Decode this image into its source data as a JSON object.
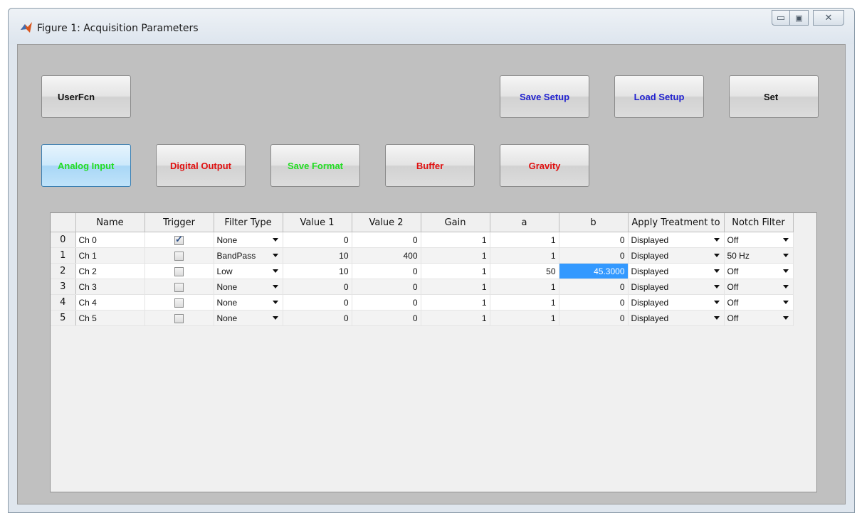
{
  "window": {
    "title": "Figure 1: Acquisition Parameters"
  },
  "buttons": {
    "userfcn": "UserFcn",
    "save_setup": "Save Setup",
    "load_setup": "Load Setup",
    "set": "Set",
    "analog_input": "Analog Input",
    "digital_output": "Digital Output",
    "save_format": "Save Format",
    "buffer": "Buffer",
    "gravity": "Gravity"
  },
  "colors": {
    "blue_label": "#1f1fd0",
    "green_label": "#22dd22",
    "red_label": "#e01010",
    "selection": "#3399ff"
  },
  "table": {
    "headers": {
      "name": "Name",
      "trigger": "Trigger",
      "filter_type": "Filter Type",
      "value1": "Value 1",
      "value2": "Value 2",
      "gain": "Gain",
      "a": "a",
      "b": "b",
      "apply": "Apply Treatment to",
      "notch": "Notch Filter"
    },
    "rows": [
      {
        "index": "0",
        "name": "Ch 0",
        "trigger": true,
        "filter": "None",
        "v1": "0",
        "v2": "0",
        "gain": "1",
        "a": "1",
        "b": "0",
        "apply": "Displayed",
        "notch": "Off"
      },
      {
        "index": "1",
        "name": "Ch 1",
        "trigger": false,
        "filter": "BandPass",
        "v1": "10",
        "v2": "400",
        "gain": "1",
        "a": "1",
        "b": "0",
        "apply": "Displayed",
        "notch": "50 Hz"
      },
      {
        "index": "2",
        "name": "Ch 2",
        "trigger": false,
        "filter": "Low",
        "v1": "10",
        "v2": "0",
        "gain": "1",
        "a": "50",
        "b": "45.3000",
        "apply": "Displayed",
        "notch": "Off"
      },
      {
        "index": "3",
        "name": "Ch 3",
        "trigger": false,
        "filter": "None",
        "v1": "0",
        "v2": "0",
        "gain": "1",
        "a": "1",
        "b": "0",
        "apply": "Displayed",
        "notch": "Off"
      },
      {
        "index": "4",
        "name": "Ch 4",
        "trigger": false,
        "filter": "None",
        "v1": "0",
        "v2": "0",
        "gain": "1",
        "a": "1",
        "b": "0",
        "apply": "Displayed",
        "notch": "Off"
      },
      {
        "index": "5",
        "name": "Ch 5",
        "trigger": false,
        "filter": "None",
        "v1": "0",
        "v2": "0",
        "gain": "1",
        "a": "1",
        "b": "0",
        "apply": "Displayed",
        "notch": "Off"
      }
    ]
  }
}
